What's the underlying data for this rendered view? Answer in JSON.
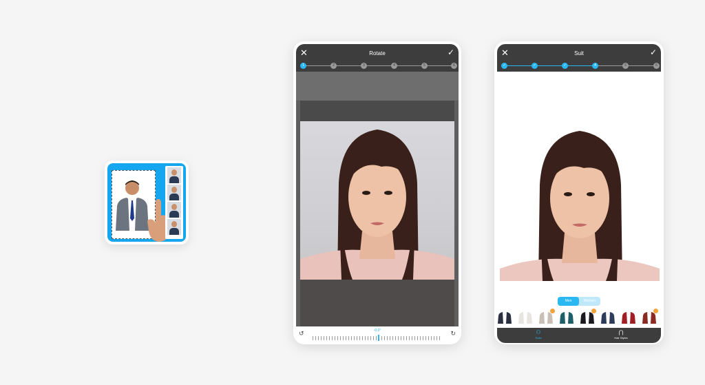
{
  "colors": {
    "accent": "#29b8f2",
    "topbar": "#3d3d3d",
    "background": "#f5f5f5"
  },
  "app_icon": {
    "name": "photo-id-app-icon"
  },
  "rotate_screen": {
    "title": "Rotate",
    "close_icon": "close-icon",
    "confirm_icon": "check-icon",
    "steps": [
      "1",
      "2",
      "3",
      "4",
      "5",
      "6"
    ],
    "active_step": 1,
    "angle": "-0.0°"
  },
  "suit_screen": {
    "title": "Suit",
    "close_icon": "close-icon",
    "confirm_icon": "check-icon",
    "steps": [
      "✓",
      "✓",
      "✓",
      "4",
      "5",
      "6"
    ],
    "active_step": 4,
    "gender_toggle": {
      "men": "Men",
      "women": "Women",
      "selected": "Men"
    },
    "suits": [
      {
        "color": "#2a3040",
        "premium": false
      },
      {
        "color": "#e8e4df",
        "premium": false
      },
      {
        "color": "#c9bfb4",
        "premium": true
      },
      {
        "color": "#1f5f6a",
        "premium": false
      },
      {
        "color": "#1b1b1f",
        "premium": true
      },
      {
        "color": "#2c3c5a",
        "premium": false
      },
      {
        "color": "#a01f24",
        "premium": false
      },
      {
        "color": "#8a2a22",
        "premium": true
      }
    ],
    "nav": [
      {
        "label": "Suits",
        "icon": "person-icon",
        "active": true
      },
      {
        "label": "Hair Styles",
        "icon": "hair-icon",
        "active": false
      }
    ]
  }
}
